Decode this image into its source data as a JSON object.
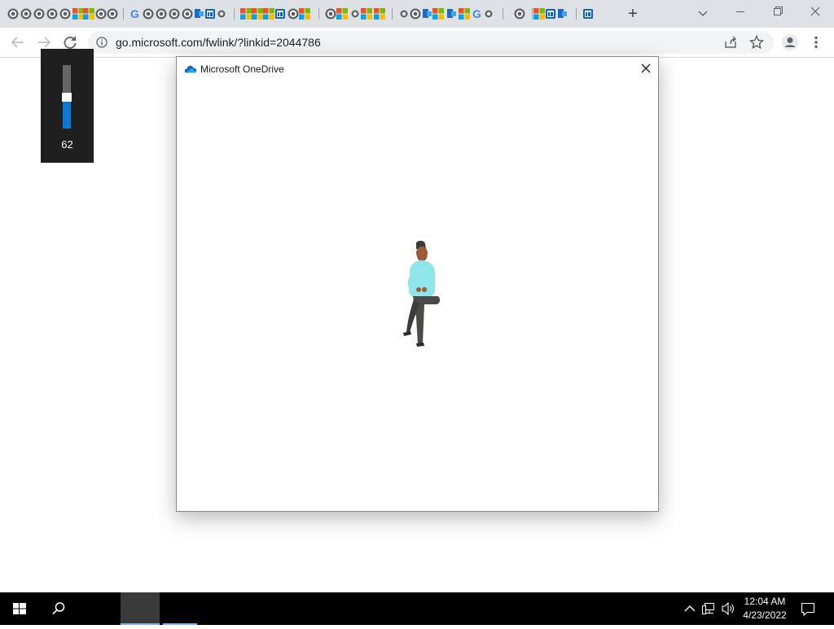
{
  "browser": {
    "url": "go.microsoft.com/fwlink/?linkid=2044786",
    "new_tab_label": "+"
  },
  "volume_flyout": {
    "value": "62",
    "level": 0.62
  },
  "dialog": {
    "title": "Microsoft OneDrive",
    "icon": "onedrive-cloud-icon"
  },
  "taskbar": {
    "time": "12:04 AM",
    "date": "4/23/2022",
    "tray_icons": [
      "chevron-up-icon",
      "network-icon",
      "speaker-icon"
    ]
  },
  "colors": {
    "accent": "#0a78d6",
    "tabstrip": "#dee1e6",
    "taskbar": "#000000",
    "person_shirt": "#8ee6ea"
  }
}
